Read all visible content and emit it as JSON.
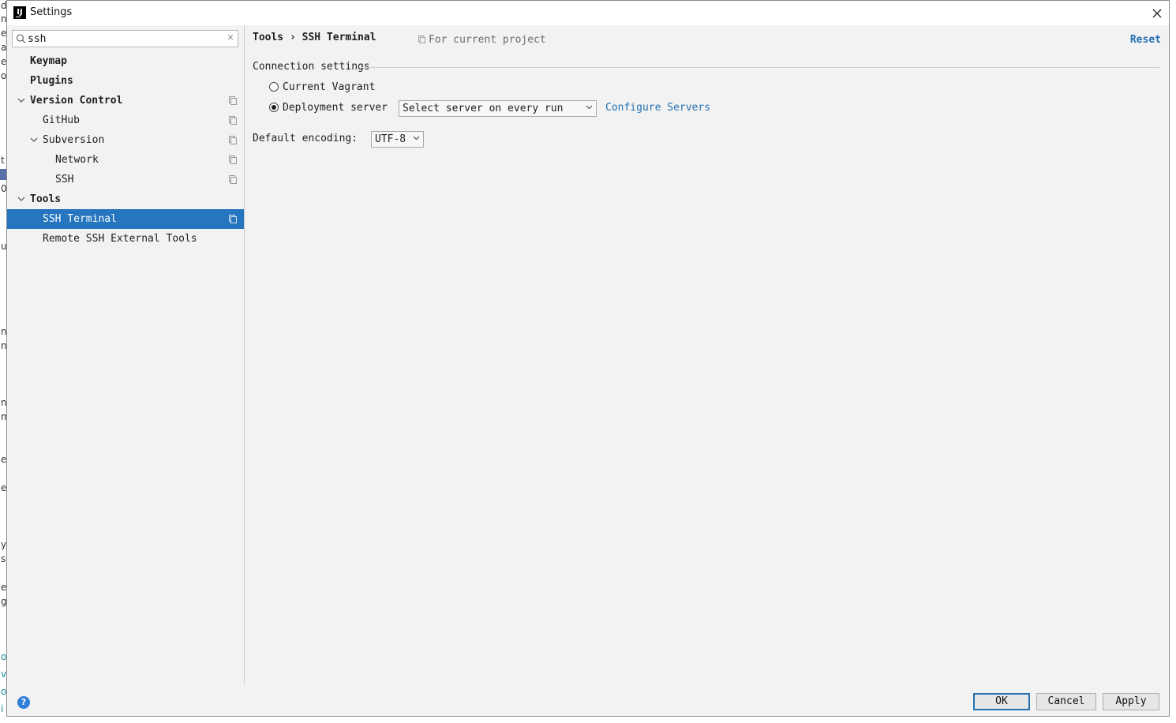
{
  "window": {
    "title": "Settings",
    "app_icon_text": "IJ"
  },
  "search": {
    "value": "ssh"
  },
  "tree": {
    "items": [
      {
        "label": "Keymap"
      },
      {
        "label": "Plugins"
      },
      {
        "label": "Version Control"
      },
      {
        "label": "GitHub"
      },
      {
        "label": "Subversion"
      },
      {
        "label": "Network"
      },
      {
        "label": "SSH"
      },
      {
        "label": "Tools"
      },
      {
        "label": "SSH Terminal"
      },
      {
        "label": "Remote SSH External Tools"
      }
    ]
  },
  "header": {
    "breadcrumb": "Tools › SSH Terminal",
    "scope": "For current project",
    "reset": "Reset"
  },
  "connection": {
    "title": "Connection settings",
    "options": [
      {
        "label": "Current Vagrant",
        "checked": false
      },
      {
        "label": "Deployment server",
        "checked": true
      }
    ],
    "server_select": "Select server on every run",
    "configure_link": "Configure Servers"
  },
  "encoding": {
    "label": "Default encoding:",
    "value": "UTF-8"
  },
  "footer": {
    "ok": "OK",
    "cancel": "Cancel",
    "apply": "Apply",
    "help": "?"
  },
  "background_strip": {
    "chars": [
      "d",
      "n",
      "e",
      "a",
      "e",
      "o",
      "t",
      "0",
      "u",
      "n",
      "n",
      "n",
      "m",
      "e",
      "e",
      "y",
      "s",
      "e",
      "g",
      "o",
      "v",
      "o",
      "i"
    ]
  },
  "colors": {
    "selection": "#2675bf",
    "link": "#2470b3",
    "panel": "#f2f2f2"
  }
}
